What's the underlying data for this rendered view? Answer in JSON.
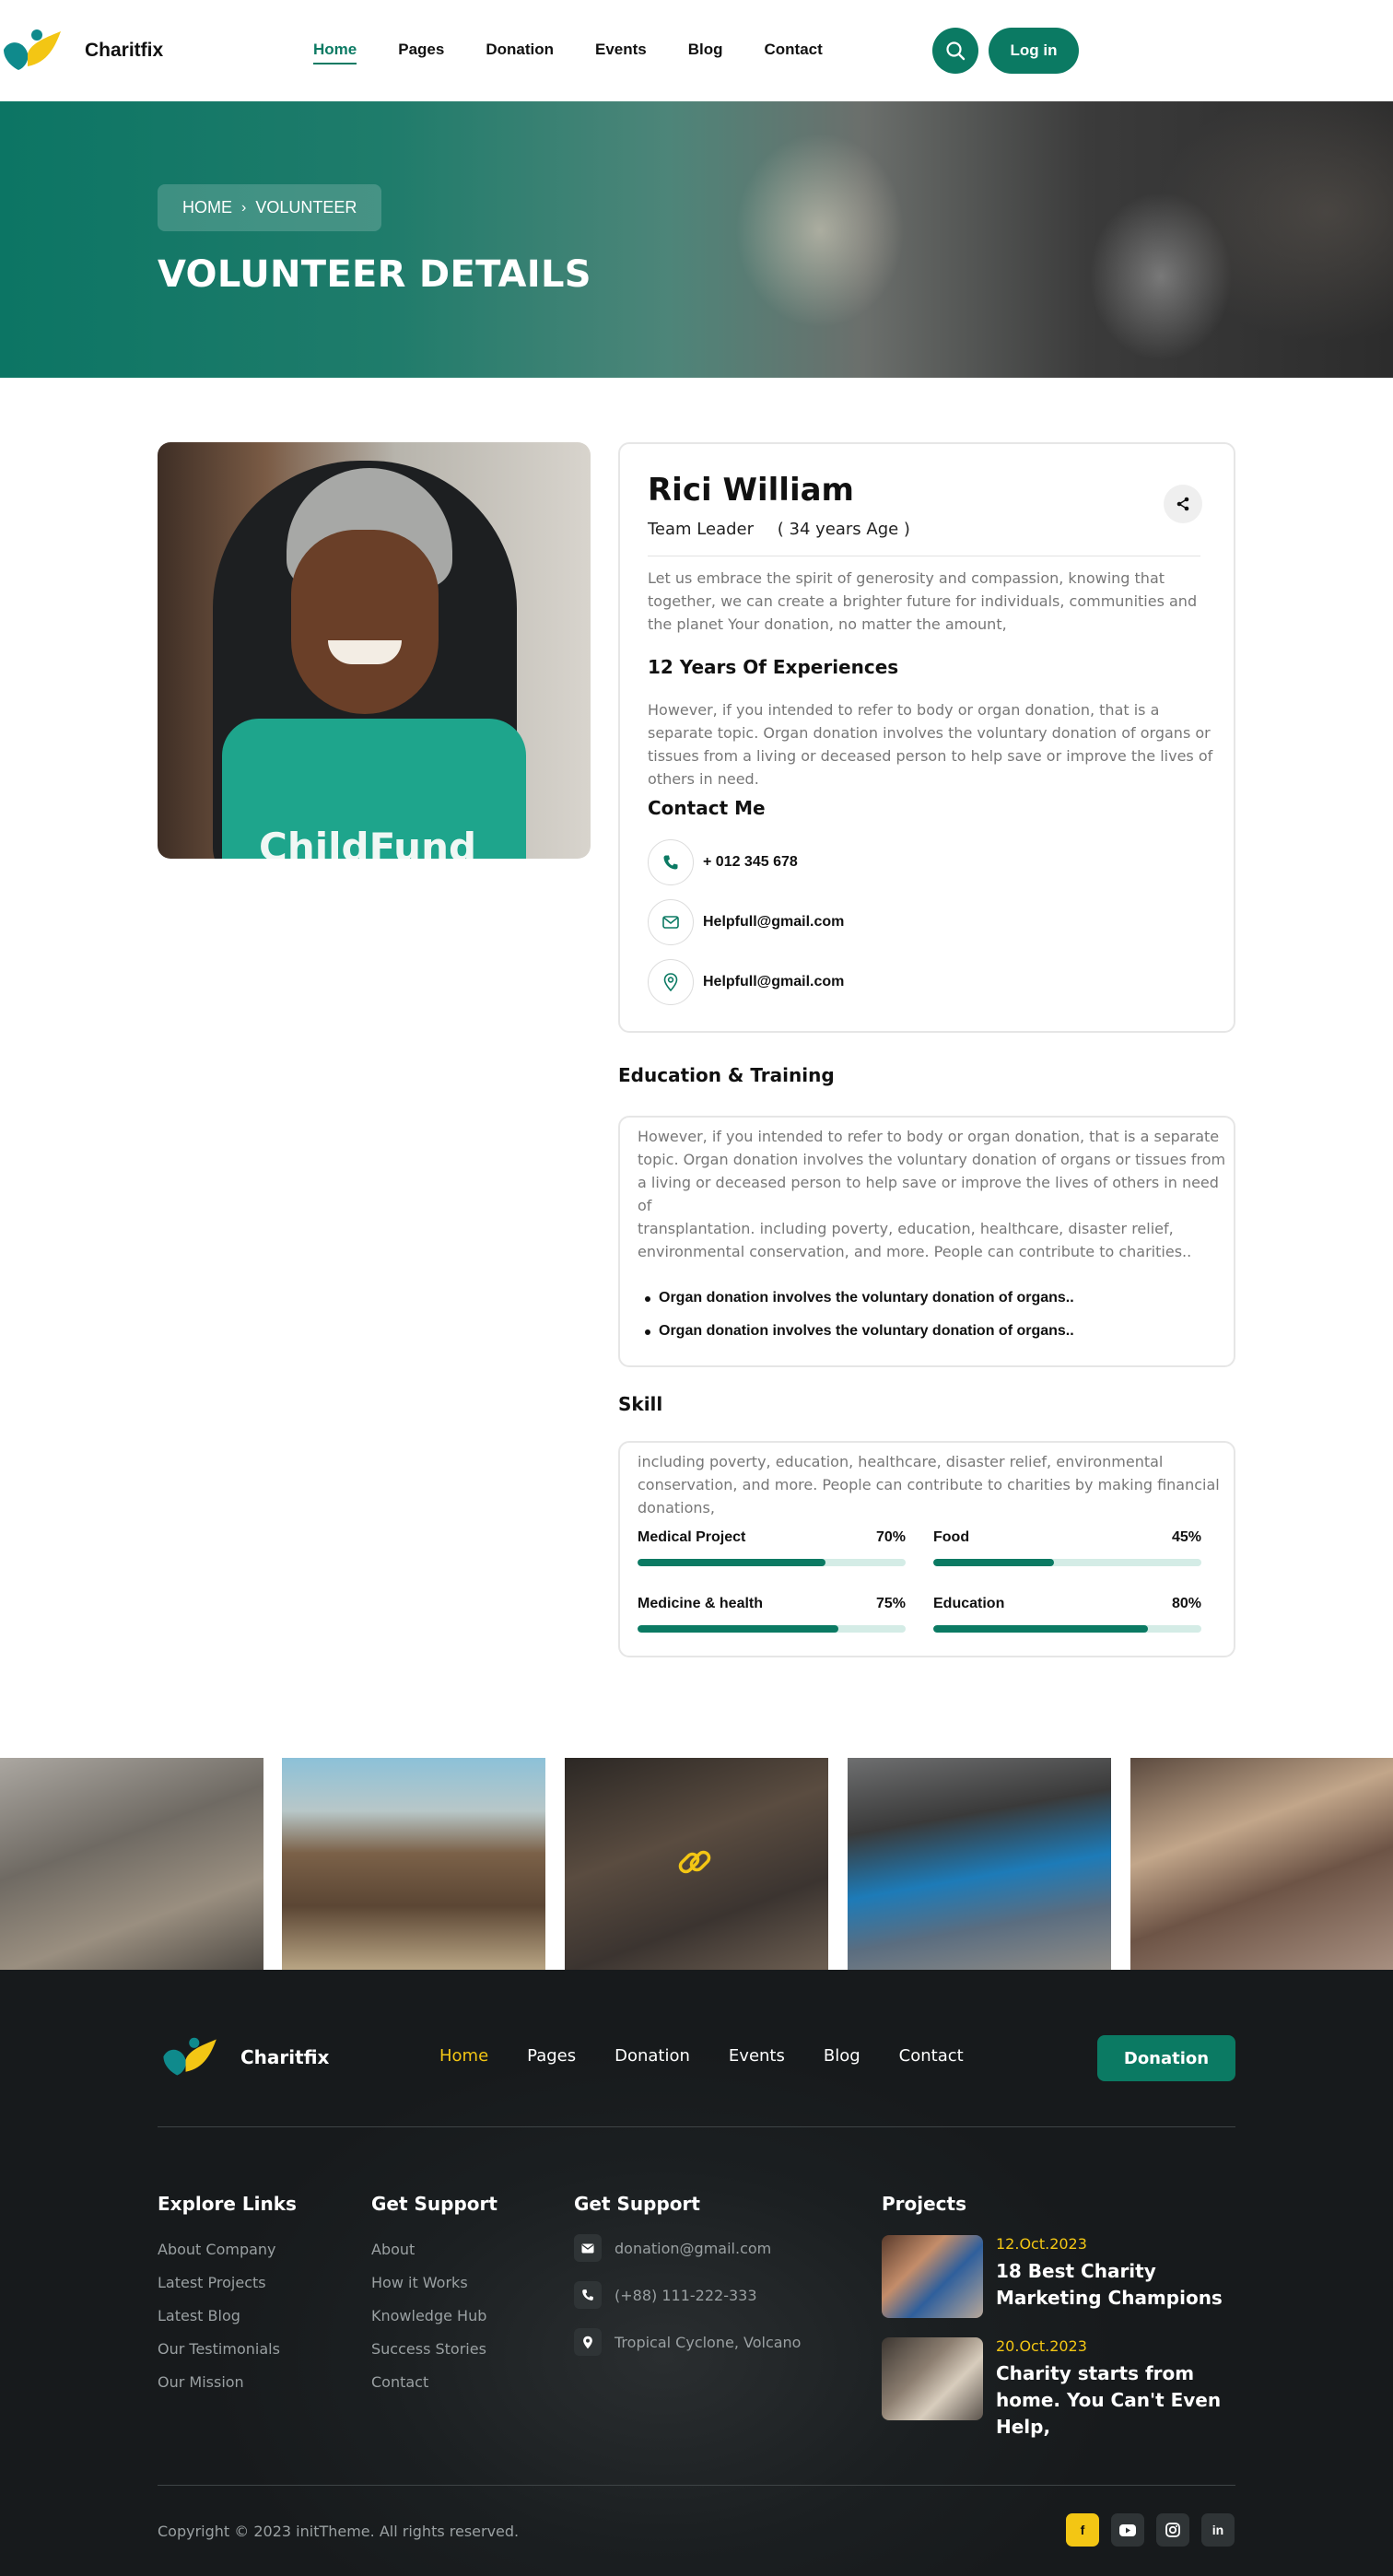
{
  "header": {
    "logo_text": "Charitfix",
    "nav": [
      {
        "label": "Home",
        "active": true
      },
      {
        "label": "Pages",
        "active": false
      },
      {
        "label": "Donation",
        "active": false
      },
      {
        "label": "Events",
        "active": false
      },
      {
        "label": "Blog",
        "active": false
      },
      {
        "label": "Contact",
        "active": false
      }
    ],
    "search_icon": "search-icon",
    "login_label": "Log in"
  },
  "hero": {
    "breadcrumb_home": "HOME",
    "breadcrumb_current": "VOLUNTEER",
    "title": "VOLUNTEER DETAILS"
  },
  "profile": {
    "photo_vest_text": "ChildFund",
    "name": "Rici William",
    "role": "Team Leader",
    "age": "( 34 years Age )",
    "intro": "Let us embrace the spirit of generosity and compassion, knowing that together, we can create a brighter future for individuals, communities and the planet Your donation, no matter the amount,",
    "experience_title": "12 Years Of Experiences",
    "experience_text": "However, if you intended to refer to body or organ donation, that is a separate topic. Organ donation involves the voluntary donation of organs or tissues from a living or deceased person to help save or improve the lives of others in need.",
    "contact_title": "Contact Me",
    "contacts": [
      {
        "icon": "phone-icon",
        "value": "+ 012 345 678"
      },
      {
        "icon": "mail-icon",
        "value": "Helpfull@gmail.com"
      },
      {
        "icon": "location-pin-icon",
        "value": "Helpfull@gmail.com"
      }
    ]
  },
  "education": {
    "title": "Education & Training",
    "paragraph1": "However, if you intended to refer to body or organ donation, that is a separate topic. Organ donation involves the voluntary donation of organs or tissues from a living or deceased person to help save or improve the lives of others in need of",
    "paragraph2": "transplantation. including poverty, education, healthcare, disaster relief, environmental conservation, and more. People can contribute to charities..",
    "bullets": [
      "Organ donation involves the voluntary donation of organs..",
      "Organ donation involves the voluntary donation of organs.."
    ]
  },
  "skill": {
    "title": "Skill",
    "paragraph": "including poverty, education, healthcare, disaster relief, environmental conservation, and more. People can contribute to charities by making financial donations,",
    "items": [
      {
        "label": "Medical Project",
        "percent_text": "70%",
        "percent": 70
      },
      {
        "label": "Food",
        "percent_text": "45%",
        "percent": 45
      },
      {
        "label": "Medicine & health",
        "percent_text": "75%",
        "percent": 75
      },
      {
        "label": "Education",
        "percent_text": "80%",
        "percent": 80
      }
    ]
  },
  "gallery": {
    "link_icon": "link-icon"
  },
  "footer": {
    "logo_text": "Charitfix",
    "nav": [
      {
        "label": "Home",
        "active": true
      },
      {
        "label": "Pages",
        "active": false
      },
      {
        "label": "Donation",
        "active": false
      },
      {
        "label": "Events",
        "active": false
      },
      {
        "label": "Blog",
        "active": false
      },
      {
        "label": "Contact",
        "active": false
      }
    ],
    "donation_label": "Donation",
    "explore_title": "Explore Links",
    "explore_links": [
      "About Company",
      "Latest Projects",
      "Latest Blog",
      "Our Testimonials",
      "Our Mission"
    ],
    "support_title": "Get Support",
    "support_links": [
      "About",
      "How it Works",
      "Knowledge Hub",
      "Success Stories",
      "Contact"
    ],
    "contact_title": "Get Support",
    "contacts": [
      {
        "icon": "mail-icon",
        "value": "donation@gmail.com"
      },
      {
        "icon": "phone-icon",
        "value": "(+88) 111-222-333"
      },
      {
        "icon": "location-pin-icon",
        "value": "Tropical Cyclone, Volcano"
      }
    ],
    "projects_title": "Projects",
    "projects": [
      {
        "date": "12.Oct.2023",
        "title": "18 Best Charity Marketing Champions"
      },
      {
        "date": "20.Oct.2023",
        "title": "Charity starts from home. You Can't Even Help,"
      }
    ],
    "copyright": "Copyright © 2023 initTheme. All rights reserved.",
    "social": [
      {
        "icon": "facebook-icon",
        "glyph": "f"
      },
      {
        "icon": "youtube-icon",
        "glyph": ""
      },
      {
        "icon": "instagram-icon",
        "glyph": ""
      },
      {
        "icon": "linkedin-icon",
        "glyph": "in"
      }
    ]
  },
  "colors": {
    "primary": "#0b7a63",
    "accent_yellow": "#f3c614",
    "footer_bg": "#1b1f21"
  }
}
